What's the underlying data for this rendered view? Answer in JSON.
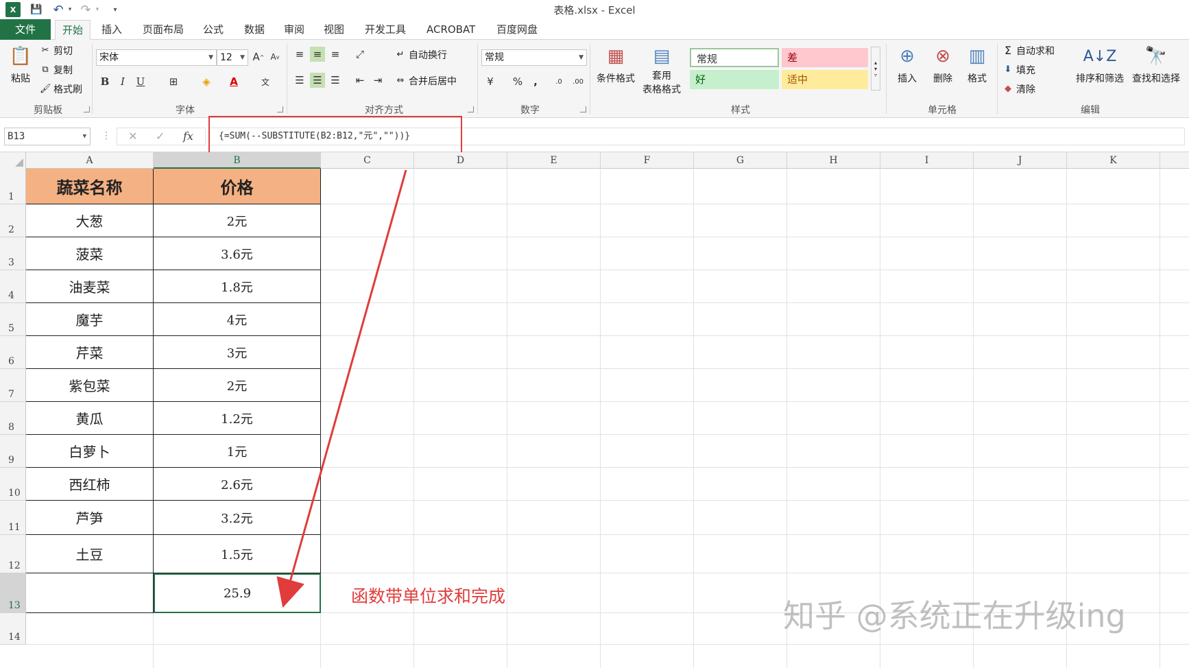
{
  "window": {
    "title": "表格.xlsx - Excel"
  },
  "quick_access": {
    "logo": "X",
    "save_icon": "💾",
    "undo_icon": "↶",
    "redo_icon": "↷",
    "customize_icon": "▾"
  },
  "tabs": [
    {
      "label": "文件"
    },
    {
      "label": "开始"
    },
    {
      "label": "插入"
    },
    {
      "label": "页面布局"
    },
    {
      "label": "公式"
    },
    {
      "label": "数据"
    },
    {
      "label": "审阅"
    },
    {
      "label": "视图"
    },
    {
      "label": "开发工具"
    },
    {
      "label": "ACROBAT"
    },
    {
      "label": "百度网盘"
    }
  ],
  "ribbon": {
    "clipboard": {
      "paste": "粘贴",
      "cut": "剪切",
      "copy": "复制",
      "format_painter": "格式刷",
      "group_label": "剪贴板"
    },
    "font": {
      "font_name": "宋体",
      "font_size": "12",
      "bold": "B",
      "italic": "I",
      "underline": "U",
      "group_label": "字体"
    },
    "alignment": {
      "wrap_text": "自动换行",
      "merge_center": "合并后居中",
      "group_label": "对齐方式"
    },
    "number": {
      "format": "常规",
      "percent": "%",
      "comma": ",",
      "group_label": "数字"
    },
    "styles": {
      "conditional": "条件格式",
      "table_format_1": "套用",
      "table_format_2": "表格格式",
      "normal": "常规",
      "bad": "差",
      "good": "好",
      "neutral": "适中",
      "group_label": "样式",
      "normal_color": "#ffffff",
      "bad_color": "#ffc7ce",
      "good_color": "#c6efce",
      "neutral_color": "#ffeb9c"
    },
    "cells": {
      "insert": "插入",
      "delete": "删除",
      "format": "格式",
      "group_label": "单元格"
    },
    "editing": {
      "autosum": "自动求和",
      "fill": "填充",
      "clear": "清除",
      "sort_filter": "排序和筛选",
      "find_select": "查找和选择",
      "group_label": "编辑"
    }
  },
  "formula_bar": {
    "name_box": "B13",
    "cancel_icon": "✕",
    "enter_icon": "✓",
    "fx_label": "fx",
    "formula": "{=SUM(--SUBSTITUTE(B2:B12,\"元\",\"\"))}"
  },
  "sheet": {
    "columns": [
      "A",
      "B",
      "C",
      "D",
      "E",
      "F",
      "G",
      "H",
      "I",
      "J",
      "K"
    ],
    "selected_column": "B",
    "rows": [
      "1",
      "2",
      "3",
      "4",
      "5",
      "6",
      "7",
      "8",
      "9",
      "10",
      "11",
      "12",
      "13",
      "14"
    ],
    "selected_row": "13",
    "header": {
      "name": "蔬菜名称",
      "price": "价格"
    },
    "items": [
      {
        "name": "大葱",
        "price": "2元"
      },
      {
        "name": "菠菜",
        "price": "3.6元"
      },
      {
        "name": "油麦菜",
        "price": "1.8元"
      },
      {
        "name": "魔芋",
        "price": "4元"
      },
      {
        "name": "芹菜",
        "price": "3元"
      },
      {
        "name": "紫包菜",
        "price": "2元"
      },
      {
        "name": "黄瓜",
        "price": "1.2元"
      },
      {
        "name": "白萝卜",
        "price": "1元"
      },
      {
        "name": "西红柿",
        "price": "2.6元"
      },
      {
        "name": "芦笋",
        "price": "3.2元"
      },
      {
        "name": "土豆",
        "price": "1.5元"
      }
    ],
    "total": "25.9",
    "header_color": "#f4b183",
    "accent_color": "#217346"
  },
  "annotation": {
    "text": "函数带单位求和完成",
    "color": "#e03c3c"
  },
  "watermark": "知乎 @系统正在升级ing"
}
